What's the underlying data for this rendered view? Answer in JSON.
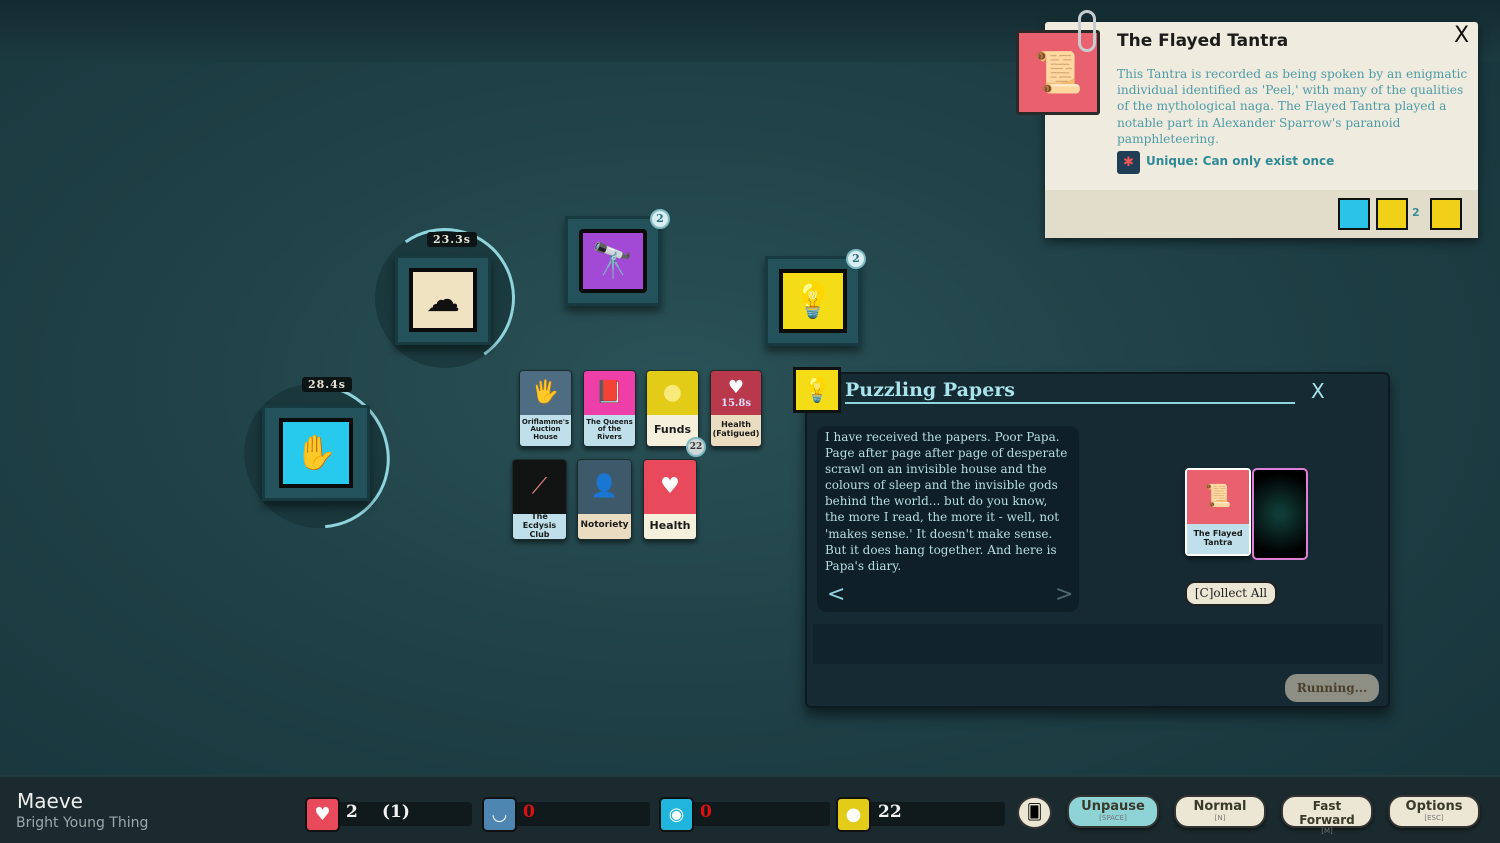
{
  "tooltip": {
    "title": "The Flayed Tantra",
    "close": "X",
    "description": "This Tantra is recorded as being spoken by an enigmatic individual identified as 'Peel,' with many of the qualities of the mythological naga. The Flayed Tantra played a notable part in Alexander Sparrow's paranoid pamphleteering.",
    "unique": "Unique: Can only exist once",
    "aspects": [
      {
        "icon": "lantern-book-icon",
        "color": "#2bc3e8"
      },
      {
        "icon": "grail-gavel-icon",
        "color": "#f0d117",
        "count": "2"
      },
      {
        "icon": "knock-book-icon",
        "color": "#f0d117"
      }
    ]
  },
  "verbs": [
    {
      "name": "dream",
      "icon": "dream-cloud-icon",
      "color": "#efe3c2",
      "timer": "23.3s"
    },
    {
      "name": "explore",
      "icon": "telescope-icon",
      "color": "#a24ad6",
      "badge": "2"
    },
    {
      "name": "study",
      "icon": "lightbulb-icon",
      "color": "#f4dc16",
      "badge": "2"
    },
    {
      "name": "work",
      "icon": "hand-icon",
      "color": "#27c9ec",
      "timer": "28.4s"
    }
  ],
  "cards": [
    {
      "label": "Oriflamme's Auction House",
      "icon": "glass-dome-hand-icon",
      "color": "#4f6d82",
      "labelColor": "#bfe0ea"
    },
    {
      "label": "The Queens of the Rivers",
      "icon": "book-icon",
      "color": "#ee3fa9",
      "labelColor": "#bfe0ea"
    },
    {
      "label": "Funds",
      "icon": "coin-icon",
      "color": "#e3cc18",
      "labelColor": "#f5f0dc",
      "count": "22"
    },
    {
      "label": "Health (Fatigued)",
      "icon": "heart-icon",
      "color": "#b9384c",
      "labelColor": "#eadcc0",
      "timer": "15.8s"
    },
    {
      "label": "The Ecdysis Club",
      "icon": "skin-icon",
      "color": "#121414",
      "labelColor": "#bfe0ea"
    },
    {
      "label": "Notoriety",
      "icon": "silhouette-icon",
      "color": "#3e5a6a",
      "labelColor": "#eadcc0"
    },
    {
      "label": "Health",
      "icon": "heart-icon",
      "color": "#e84a5c",
      "labelColor": "#f5f0dc"
    }
  ],
  "situation": {
    "title": "Puzzling Papers",
    "close": "X",
    "text": "I have received the papers. Poor Papa. Page after page after page of desperate scrawl on an invisible house and the colours of sleep and the invisible gods behind the world... but do you know, the more I read, the more it - well, not 'makes sense.' It doesn't make sense. But it does hang together. And here is Papa's diary.",
    "prev": "<",
    "next": ">",
    "output_card": "The Flayed Tantra",
    "collect": "[C]ollect All",
    "status": "Running..."
  },
  "player": {
    "name": "Maeve",
    "title": "Bright Young Thing"
  },
  "resources": [
    {
      "name": "health",
      "icon": "heart-icon",
      "color": "#e84a5c",
      "value": "2",
      "extra": "(1)"
    },
    {
      "name": "passion",
      "icon": "passion-icon",
      "color": "#4d86b0",
      "value": "0",
      "valueColor": "#e01010"
    },
    {
      "name": "reason",
      "icon": "eye-icon",
      "color": "#1fb5dc",
      "value": "0",
      "valueColor": "#e01010"
    },
    {
      "name": "funds",
      "icon": "coin-icon",
      "color": "#e3cc18",
      "value": "22"
    }
  ],
  "controls": [
    {
      "label": "Unpause",
      "key": "[SPACE]",
      "active": true
    },
    {
      "label": "Normal",
      "key": "[N]"
    },
    {
      "label": "Fast Forward",
      "key": "[M]"
    },
    {
      "label": "Options",
      "key": "[ESC]"
    }
  ]
}
